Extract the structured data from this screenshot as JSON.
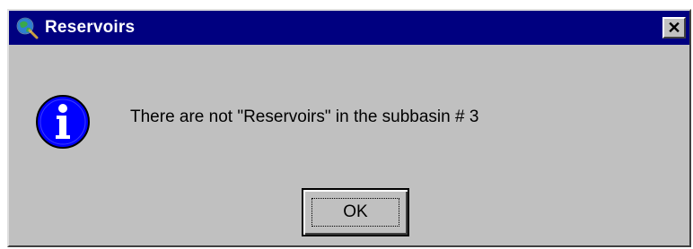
{
  "window": {
    "title": "Reservoirs",
    "close_label": "✕"
  },
  "dialog": {
    "icon": "information-icon",
    "message": "There are not \"Reservoirs\" in the subbasin # 3",
    "ok_label": "OK"
  },
  "colors": {
    "titlebar": "#000080",
    "face": "#c0c0c0",
    "info_icon": "#0000ff"
  }
}
